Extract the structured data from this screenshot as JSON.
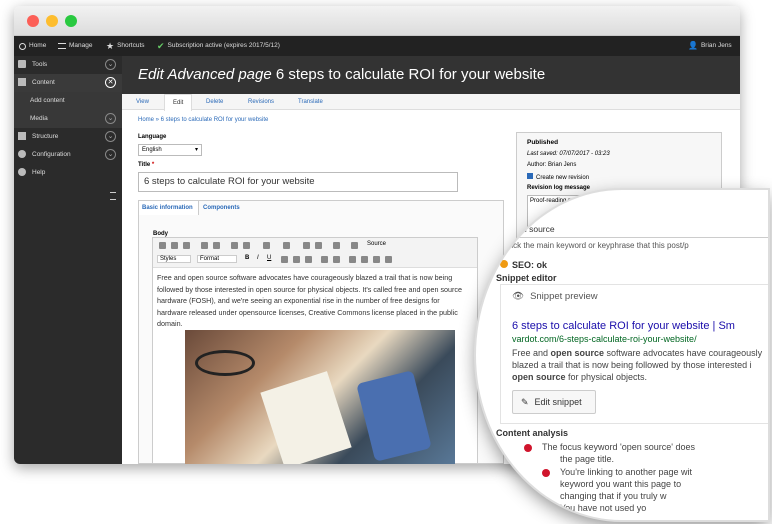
{
  "toolbar": {
    "home": "Home",
    "manage": "Manage",
    "shortcuts": "Shortcuts",
    "subscription": "Subscription active (expires 2017/5/12)",
    "user": "Brian Jens"
  },
  "sidebar": {
    "items": [
      {
        "label": "Tools"
      },
      {
        "label": "Content"
      },
      {
        "label": "Add content"
      },
      {
        "label": "Media"
      },
      {
        "label": "Structure"
      },
      {
        "label": "Configuration"
      },
      {
        "label": "Help"
      }
    ]
  },
  "header": {
    "prefix": "Edit Advanced page",
    "title": "6 steps to calculate ROI for your website"
  },
  "tabs": [
    "View",
    "Edit",
    "Delete",
    "Revisions",
    "Translate"
  ],
  "breadcrumb": "Home » 6 steps to calculate ROI for your website",
  "form": {
    "language_label": "Language",
    "language_value": "English",
    "title_label": "Title",
    "title_value": "6 steps to calculate ROI for your website",
    "subtabs": [
      "Basic information",
      "Components"
    ],
    "body_label": "Body",
    "styles": "Styles",
    "format": "Format",
    "source": "Source",
    "body_text": "Free and open source software advocates have courageously blazed a trail that is now being followed by those interested in open source for physical objects. It's called free and open source hardware (FOSH), and we're seeing an exponential rise in the number of free designs for hardware released under opensource licenses, Creative Commons license placed in the public domain."
  },
  "publish": {
    "title": "Published",
    "last_saved": "Last saved: 07/07/2017 - 03:23",
    "author": "Author: Brian Jens",
    "create_revision": "Create new revision",
    "revision_log_label": "Revision log message",
    "revision_log_value": "Proof-reading paragraphs"
  },
  "lens": {
    "keyword_value": "n source",
    "keyword_hint": "Pick the main keyword or keyphrase that this post/p",
    "seo_status": "SEO: ok",
    "snippet_editor": "Snippet editor",
    "snippet_preview": "Snippet preview",
    "snippet_title": "6 steps to calculate ROI for your website | Sm",
    "snippet_url": "vardot.com/6-steps-calculate-roi-your-website/",
    "snippet_desc_1": "Free and ",
    "snippet_desc_b1": "open source",
    "snippet_desc_2": " software advocates have courageously",
    "snippet_desc_3": "blazed a trail that is now being followed by those interested i",
    "snippet_desc_b2": "open source",
    "snippet_desc_4": " for physical objects.",
    "edit_snippet": "Edit snippet",
    "content_analysis": "Content analysis",
    "analysis": [
      "The focus keyword 'open source' does",
      "the page title.",
      "You're linking to another page wit",
      "keyword you want this page to",
      "changing that if you truly w",
      "You have not used yo"
    ]
  },
  "colors": {
    "accent": "#2b6ab8",
    "seo_ok": "#ef9a12",
    "problem": "#d0142c"
  }
}
